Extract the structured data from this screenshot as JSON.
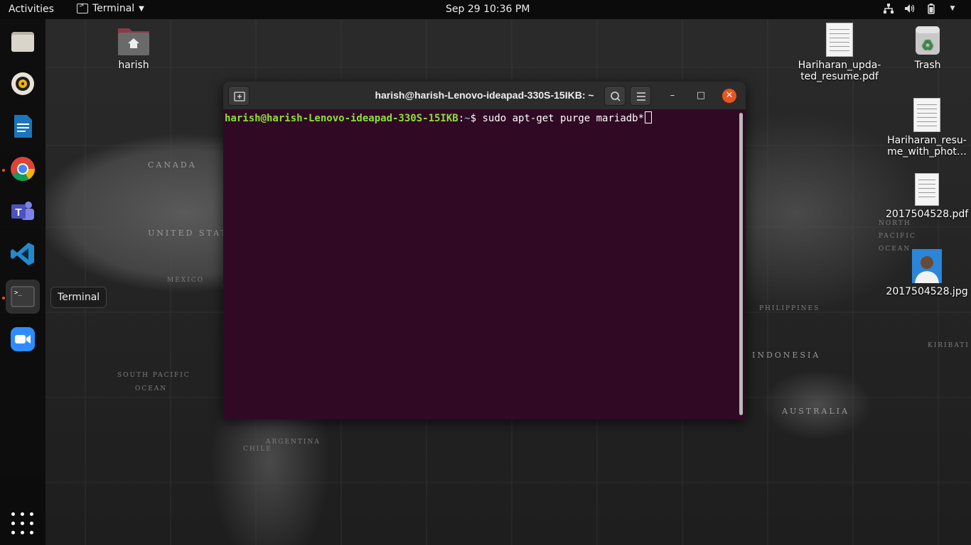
{
  "topbar": {
    "activities": "Activities",
    "app_menu": "Terminal",
    "clock": "Sep 29  10:36 PM",
    "tray": [
      "network-icon",
      "volume-icon",
      "battery-icon",
      "power-menu-icon"
    ]
  },
  "dock": {
    "items": [
      {
        "name": "files",
        "icon": "files-icon"
      },
      {
        "name": "rhythmbox",
        "icon": "rhythmbox-icon"
      },
      {
        "name": "libreoffice-writer",
        "icon": "writer-icon"
      },
      {
        "name": "google-chrome",
        "icon": "chrome-icon",
        "running": true
      },
      {
        "name": "microsoft-teams",
        "icon": "teams-icon"
      },
      {
        "name": "visual-studio-code",
        "icon": "vscode-icon"
      },
      {
        "name": "terminal",
        "icon": "terminal-icon",
        "running": true,
        "active": true
      },
      {
        "name": "zoom",
        "icon": "zoom-icon"
      }
    ],
    "tooltip": "Terminal",
    "accent_color": "#e95420"
  },
  "desktop": {
    "home_label": "harish",
    "trash_label": "Trash",
    "files": [
      {
        "label_line1": "Hariharan_upda-",
        "label_line2": "ted_resume.pdf"
      },
      {
        "label_line1": "Hariharan_resu-",
        "label_line2": "me_with_phot…"
      },
      {
        "label_line1": "2017504528.pdf",
        "label_line2": ""
      },
      {
        "label_line1": "2017504528.jpg",
        "label_line2": ""
      }
    ],
    "map_labels": [
      "CANADA",
      "UNITED STATES",
      "MEXICO",
      "SOUTH PACIFIC",
      "OCEAN",
      "PHILIPPINES",
      "INDONESIA",
      "AUSTRALIA",
      "KIRIBATI",
      "NORTH",
      "PACIFIC",
      "OCEAN",
      "ARGENTINA",
      "CHILE"
    ]
  },
  "terminal": {
    "title": "harish@harish-Lenovo-ideapad-330S-15IKB: ~",
    "prompt_user": "harish@harish-Lenovo-ideapad-330S-15IKB",
    "prompt_colon": ":",
    "prompt_path": "~",
    "prompt_symbol": "$ ",
    "command": "sudo apt-get purge mariadb*",
    "background": "#300a24"
  }
}
